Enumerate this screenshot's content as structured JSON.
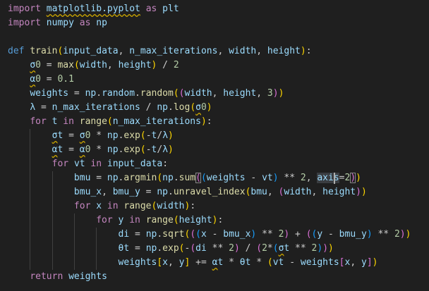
{
  "colors": {
    "background": "#1f1f1f",
    "keyword": "#c586c0",
    "storage": "#569cd6",
    "function": "#dcdcaa",
    "variable": "#9cdcfe",
    "number": "#b5cea8",
    "plain": "#cccccc",
    "bracket1": "#ffd700",
    "bracket2": "#da70d6",
    "bracket3": "#179fff",
    "squiggle": "#cca700"
  },
  "lines": [
    [
      [
        "import",
        "keyword"
      ],
      [
        " ",
        "plain"
      ],
      [
        "matplotlib.pyplot",
        "variable",
        "sq"
      ],
      [
        " ",
        "plain"
      ],
      [
        "as",
        "keyword"
      ],
      [
        " ",
        "plain"
      ],
      [
        "plt",
        "variable"
      ]
    ],
    [
      [
        "import",
        "keyword"
      ],
      [
        " ",
        "plain"
      ],
      [
        "numpy",
        "variable"
      ],
      [
        " ",
        "plain"
      ],
      [
        "as",
        "keyword"
      ],
      [
        " ",
        "plain"
      ],
      [
        "np",
        "variable"
      ]
    ],
    [],
    [
      [
        "def",
        "storage"
      ],
      [
        " ",
        "plain"
      ],
      [
        "train",
        "function"
      ],
      [
        "(",
        "bracket1"
      ],
      [
        "input_data",
        "variable"
      ],
      [
        ", ",
        "plain"
      ],
      [
        "n_max_iterations",
        "variable"
      ],
      [
        ", ",
        "plain"
      ],
      [
        "width",
        "variable"
      ],
      [
        ", ",
        "plain"
      ],
      [
        "height",
        "variable"
      ],
      [
        ")",
        "bracket1"
      ],
      [
        ":",
        "plain"
      ]
    ],
    [
      [
        "    ",
        "plain"
      ],
      [
        "σ",
        "variable",
        "sq"
      ],
      [
        "0",
        "number"
      ],
      [
        " = ",
        "plain"
      ],
      [
        "max",
        "function"
      ],
      [
        "(",
        "bracket1"
      ],
      [
        "width",
        "variable"
      ],
      [
        ", ",
        "plain"
      ],
      [
        "height",
        "variable"
      ],
      [
        ")",
        "bracket1"
      ],
      [
        " / ",
        "plain"
      ],
      [
        "2",
        "number"
      ]
    ],
    [
      [
        "    ",
        "plain"
      ],
      [
        "α",
        "variable",
        "sq"
      ],
      [
        "0",
        "number"
      ],
      [
        " = ",
        "plain"
      ],
      [
        "0.1",
        "number"
      ]
    ],
    [
      [
        "    ",
        "plain"
      ],
      [
        "weights",
        "variable"
      ],
      [
        " = ",
        "plain"
      ],
      [
        "np",
        "variable"
      ],
      [
        ".",
        "plain"
      ],
      [
        "random",
        "variable"
      ],
      [
        ".",
        "plain"
      ],
      [
        "random",
        "function"
      ],
      [
        "(",
        "bracket1"
      ],
      [
        "(",
        "bracket2"
      ],
      [
        "width",
        "variable"
      ],
      [
        ", ",
        "plain"
      ],
      [
        "height",
        "variable"
      ],
      [
        ", ",
        "plain"
      ],
      [
        "3",
        "number"
      ],
      [
        ")",
        "bracket2"
      ],
      [
        ")",
        "bracket1"
      ]
    ],
    [
      [
        "    ",
        "plain"
      ],
      [
        "λ",
        "variable"
      ],
      [
        " = ",
        "plain"
      ],
      [
        "n_max_iterations",
        "variable"
      ],
      [
        " / ",
        "plain"
      ],
      [
        "np",
        "variable"
      ],
      [
        ".",
        "plain"
      ],
      [
        "log",
        "function"
      ],
      [
        "(",
        "bracket1"
      ],
      [
        "σ",
        "variable",
        "sq"
      ],
      [
        "0",
        "number"
      ],
      [
        ")",
        "bracket1"
      ]
    ],
    [
      [
        "    ",
        "plain"
      ],
      [
        "for",
        "keyword"
      ],
      [
        " ",
        "plain"
      ],
      [
        "t",
        "variable"
      ],
      [
        " ",
        "plain"
      ],
      [
        "in",
        "keyword"
      ],
      [
        " ",
        "plain"
      ],
      [
        "range",
        "function"
      ],
      [
        "(",
        "bracket1"
      ],
      [
        "n_max_iterations",
        "variable"
      ],
      [
        ")",
        "bracket1"
      ],
      [
        ":",
        "plain"
      ]
    ],
    [
      [
        "        ",
        "plain"
      ],
      [
        "σ",
        "variable",
        "sq"
      ],
      [
        "t",
        "variable"
      ],
      [
        " = ",
        "plain"
      ],
      [
        "σ",
        "variable",
        "sq"
      ],
      [
        "0",
        "number"
      ],
      [
        " * ",
        "plain"
      ],
      [
        "np",
        "variable"
      ],
      [
        ".",
        "plain"
      ],
      [
        "exp",
        "function"
      ],
      [
        "(",
        "bracket1"
      ],
      [
        "-",
        "plain"
      ],
      [
        "t",
        "variable"
      ],
      [
        "/",
        "plain"
      ],
      [
        "λ",
        "variable"
      ],
      [
        ")",
        "bracket1"
      ]
    ],
    [
      [
        "        ",
        "plain"
      ],
      [
        "α",
        "variable",
        "sq"
      ],
      [
        "t",
        "variable"
      ],
      [
        " = ",
        "plain"
      ],
      [
        "α",
        "variable",
        "sq"
      ],
      [
        "0",
        "number"
      ],
      [
        " * ",
        "plain"
      ],
      [
        "np",
        "variable"
      ],
      [
        ".",
        "plain"
      ],
      [
        "exp",
        "function"
      ],
      [
        "(",
        "bracket1"
      ],
      [
        "-",
        "plain"
      ],
      [
        "t",
        "variable"
      ],
      [
        "/",
        "plain"
      ],
      [
        "λ",
        "variable"
      ],
      [
        ")",
        "bracket1"
      ]
    ],
    [
      [
        "        ",
        "plain"
      ],
      [
        "for",
        "keyword"
      ],
      [
        " ",
        "plain"
      ],
      [
        "vt",
        "variable"
      ],
      [
        " ",
        "plain"
      ],
      [
        "in",
        "keyword"
      ],
      [
        " ",
        "plain"
      ],
      [
        "input_data",
        "variable"
      ],
      [
        ":",
        "plain"
      ]
    ],
    [
      [
        "            ",
        "plain"
      ],
      [
        "bmu",
        "variable"
      ],
      [
        " = ",
        "plain"
      ],
      [
        "np",
        "variable"
      ],
      [
        ".",
        "plain"
      ],
      [
        "argmin",
        "function"
      ],
      [
        "(",
        "bracket1"
      ],
      [
        "np",
        "variable"
      ],
      [
        ".",
        "plain"
      ],
      [
        "sum",
        "function"
      ],
      [
        "(",
        "bracket2",
        "box"
      ],
      [
        "(",
        "bracket3"
      ],
      [
        "weights",
        "variable"
      ],
      [
        " - ",
        "plain"
      ],
      [
        "vt",
        "variable"
      ],
      [
        ")",
        "bracket3"
      ],
      [
        " ** ",
        "plain"
      ],
      [
        "2",
        "number"
      ],
      [
        ", ",
        "plain"
      ],
      [
        "axis",
        "variable",
        "hl"
      ],
      [
        "=",
        "plain"
      ],
      [
        "2",
        "number"
      ],
      [
        ")",
        "bracket2",
        "box"
      ],
      [
        ")",
        "bracket1"
      ]
    ],
    [
      [
        "            ",
        "plain"
      ],
      [
        "bmu_x",
        "variable"
      ],
      [
        ", ",
        "plain"
      ],
      [
        "bmu_y",
        "variable"
      ],
      [
        " = ",
        "plain"
      ],
      [
        "np",
        "variable"
      ],
      [
        ".",
        "plain"
      ],
      [
        "unravel_index",
        "function"
      ],
      [
        "(",
        "bracket1"
      ],
      [
        "bmu",
        "variable"
      ],
      [
        ", ",
        "plain"
      ],
      [
        "(",
        "bracket2"
      ],
      [
        "width",
        "variable"
      ],
      [
        ", ",
        "plain"
      ],
      [
        "height",
        "variable"
      ],
      [
        ")",
        "bracket2"
      ],
      [
        ")",
        "bracket1"
      ]
    ],
    [
      [
        "            ",
        "plain"
      ],
      [
        "for",
        "keyword"
      ],
      [
        " ",
        "plain"
      ],
      [
        "x",
        "variable"
      ],
      [
        " ",
        "plain"
      ],
      [
        "in",
        "keyword"
      ],
      [
        " ",
        "plain"
      ],
      [
        "range",
        "function"
      ],
      [
        "(",
        "bracket1"
      ],
      [
        "width",
        "variable"
      ],
      [
        ")",
        "bracket1"
      ],
      [
        ":",
        "plain"
      ]
    ],
    [
      [
        "                ",
        "plain"
      ],
      [
        "for",
        "keyword"
      ],
      [
        " ",
        "plain"
      ],
      [
        "y",
        "variable"
      ],
      [
        " ",
        "plain"
      ],
      [
        "in",
        "keyword"
      ],
      [
        " ",
        "plain"
      ],
      [
        "range",
        "function"
      ],
      [
        "(",
        "bracket1"
      ],
      [
        "height",
        "variable"
      ],
      [
        ")",
        "bracket1"
      ],
      [
        ":",
        "plain"
      ]
    ],
    [
      [
        "                    ",
        "plain"
      ],
      [
        "di",
        "variable"
      ],
      [
        " = ",
        "plain"
      ],
      [
        "np",
        "variable"
      ],
      [
        ".",
        "plain"
      ],
      [
        "sqrt",
        "function"
      ],
      [
        "(",
        "bracket1"
      ],
      [
        "(",
        "bracket2"
      ],
      [
        "(",
        "bracket3"
      ],
      [
        "x",
        "variable"
      ],
      [
        " - ",
        "plain"
      ],
      [
        "bmu_x",
        "variable"
      ],
      [
        ")",
        "bracket3"
      ],
      [
        " ** ",
        "plain"
      ],
      [
        "2",
        "number"
      ],
      [
        ")",
        "bracket2"
      ],
      [
        " + ",
        "plain"
      ],
      [
        "(",
        "bracket2"
      ],
      [
        "(",
        "bracket3"
      ],
      [
        "y",
        "variable"
      ],
      [
        " - ",
        "plain"
      ],
      [
        "bmu_y",
        "variable"
      ],
      [
        ")",
        "bracket3"
      ],
      [
        " ** ",
        "plain"
      ],
      [
        "2",
        "number"
      ],
      [
        ")",
        "bracket2"
      ],
      [
        ")",
        "bracket1"
      ]
    ],
    [
      [
        "                    ",
        "plain"
      ],
      [
        "θt",
        "variable"
      ],
      [
        " = ",
        "plain"
      ],
      [
        "np",
        "variable"
      ],
      [
        ".",
        "plain"
      ],
      [
        "exp",
        "function"
      ],
      [
        "(",
        "bracket1"
      ],
      [
        "-",
        "plain"
      ],
      [
        "(",
        "bracket2"
      ],
      [
        "di",
        "variable"
      ],
      [
        " ** ",
        "plain"
      ],
      [
        "2",
        "number"
      ],
      [
        ")",
        "bracket2"
      ],
      [
        " / ",
        "plain"
      ],
      [
        "(",
        "bracket2"
      ],
      [
        "2",
        "number"
      ],
      [
        "*",
        "plain"
      ],
      [
        "(",
        "bracket3"
      ],
      [
        "σ",
        "variable",
        "sq"
      ],
      [
        "t",
        "variable"
      ],
      [
        " ** ",
        "plain"
      ],
      [
        "2",
        "number"
      ],
      [
        ")",
        "bracket3"
      ],
      [
        ")",
        "bracket2"
      ],
      [
        ")",
        "bracket1"
      ]
    ],
    [
      [
        "                    ",
        "plain"
      ],
      [
        "weights",
        "variable"
      ],
      [
        "[",
        "bracket1"
      ],
      [
        "x",
        "variable"
      ],
      [
        ", ",
        "plain"
      ],
      [
        "y",
        "variable"
      ],
      [
        "]",
        "bracket1"
      ],
      [
        " += ",
        "plain"
      ],
      [
        "α",
        "variable",
        "sq"
      ],
      [
        "t",
        "variable"
      ],
      [
        " * ",
        "plain"
      ],
      [
        "θt",
        "variable"
      ],
      [
        " * ",
        "plain"
      ],
      [
        "(",
        "bracket1"
      ],
      [
        "vt",
        "variable"
      ],
      [
        " - ",
        "plain"
      ],
      [
        "weights",
        "variable"
      ],
      [
        "[",
        "bracket2"
      ],
      [
        "x",
        "variable"
      ],
      [
        ", ",
        "plain"
      ],
      [
        "y",
        "variable"
      ],
      [
        "]",
        "bracket2"
      ],
      [
        ")",
        "bracket1"
      ]
    ],
    [
      [
        "    ",
        "plain"
      ],
      [
        "return",
        "keyword"
      ],
      [
        " ",
        "plain"
      ],
      [
        "weights",
        "variable"
      ]
    ]
  ]
}
